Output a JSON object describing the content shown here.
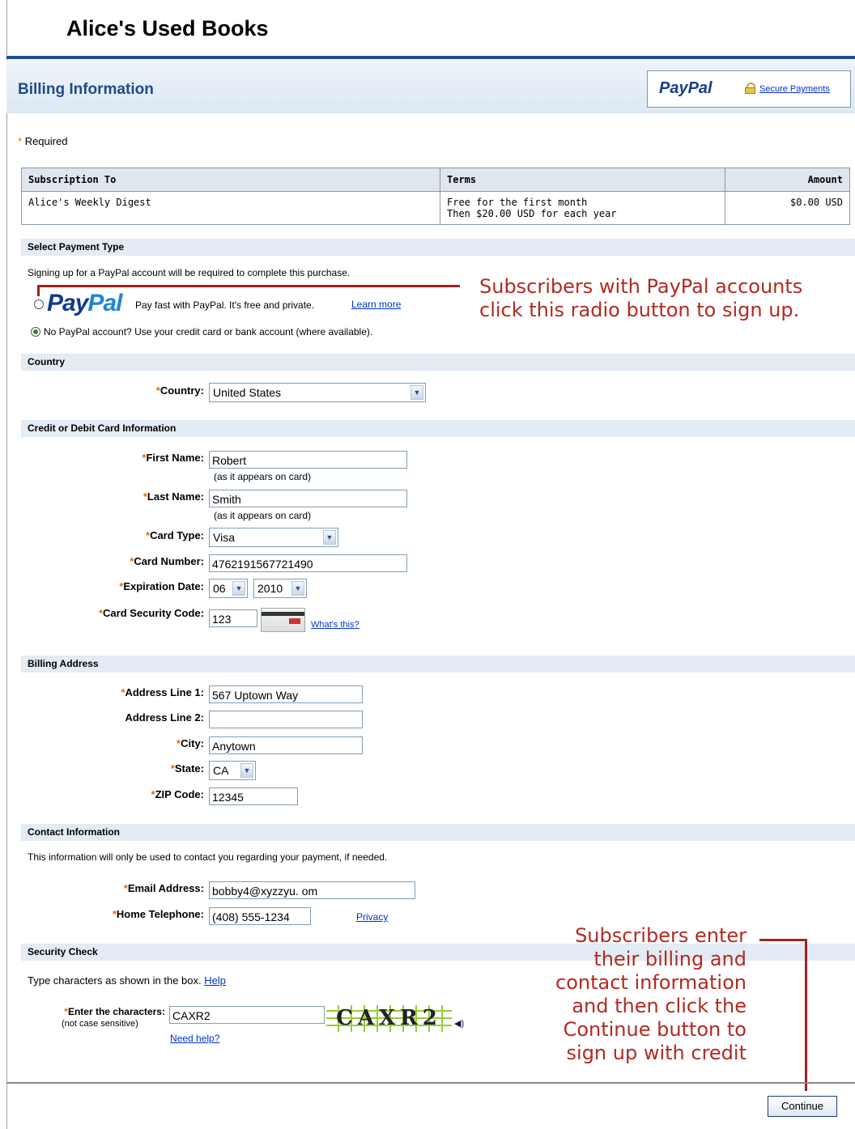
{
  "header": {
    "store_title": "Alice's Used Books",
    "billing_title": "Billing Information"
  },
  "paypal_box": {
    "logo": "PayPal",
    "secure_link": "Secure Payments",
    "icon": "lock-icon"
  },
  "required_note": {
    "star": "*",
    "text": "Required"
  },
  "subscription_table": {
    "headers": [
      "Subscription To",
      "Terms",
      "Amount"
    ],
    "row": {
      "name": "Alice's Weekly Digest",
      "terms_line1": "Free for the first month",
      "terms_line2": "Then $20.00 USD for each year",
      "amount": "$0.00 USD"
    }
  },
  "payment_type": {
    "section_label": "Select Payment Type",
    "intro": "Signing up for a PayPal account will be required to complete this purchase.",
    "paypal_logo_pay": "Pay",
    "paypal_logo_pal": "Pal",
    "paypal_option_text": "Pay fast with PayPal. It's free and private.",
    "learn_more": "Learn more",
    "no_paypal_text": "No PayPal account? Use your credit card or bank account (where available)."
  },
  "country": {
    "section_label": "Country",
    "label": "Country:",
    "value": "United States"
  },
  "card": {
    "section_label": "Credit or Debit Card Information",
    "first_name_label": "First Name:",
    "first_name": "Robert",
    "as_appears": "(as it appears on card)",
    "last_name_label": "Last Name:",
    "last_name": "Smith",
    "card_type_label": "Card Type:",
    "card_type": "Visa",
    "card_number_label": "Card Number:",
    "card_number": "4762191567721490",
    "expiration_label": "Expiration Date:",
    "exp_month": "06",
    "exp_year": "2010",
    "security_label": "Card Security Code:",
    "security_code": "123",
    "whats_this": "What's this?"
  },
  "billing_address": {
    "section_label": "Billing Address",
    "line1_label": "Address Line 1:",
    "line1": "567 Uptown Way",
    "line2_label": "Address Line 2:",
    "line2": "",
    "city_label": "City:",
    "city": "Anytown",
    "state_label": "State:",
    "state": "CA",
    "zip_label": "ZIP Code:",
    "zip": "12345"
  },
  "contact": {
    "section_label": "Contact Information",
    "intro": "This information will only be used to contact you regarding your payment, if needed.",
    "email_label": "Email Address:",
    "email": "bobby4@xyzzyu. om",
    "phone_label": "Home Telephone:",
    "phone": "(408) 555-1234",
    "privacy": "Privacy"
  },
  "security_check": {
    "section_label": "Security Check",
    "intro": "Type characters as shown in the box.",
    "help": "Help",
    "enter_label": "Enter the characters:",
    "not_case": "(not case sensitive)",
    "value": "CAXR2",
    "captcha_text": "CAXR2",
    "need_help": "Need help?"
  },
  "callouts": {
    "paypal_line1": "Subscribers with PayPal accounts",
    "paypal_line2": "click this radio button to sign up.",
    "continue_lines": [
      "Subscribers enter",
      "their billing and",
      "contact information",
      "and then click the",
      "Continue button to",
      "sign up with credit"
    ]
  },
  "continue_button": "Continue",
  "colors": {
    "accent": "#1b4f8d",
    "callout": "#b22a22",
    "required": "#e07000"
  }
}
